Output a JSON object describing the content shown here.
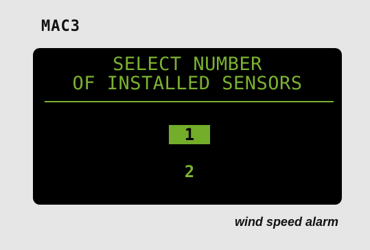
{
  "brand": "MAC3",
  "screen": {
    "title_line1": "SELECT NUMBER",
    "title_line2": "OF INSTALLED SENSORS",
    "options": [
      {
        "label": "1",
        "selected": true
      },
      {
        "label": "2",
        "selected": false
      }
    ]
  },
  "caption": "wind speed alarm",
  "colors": {
    "background": "#e6e6e6",
    "screen": "#000000",
    "accent_green": "#7cb230",
    "highlight_green": "#74ad2a"
  }
}
